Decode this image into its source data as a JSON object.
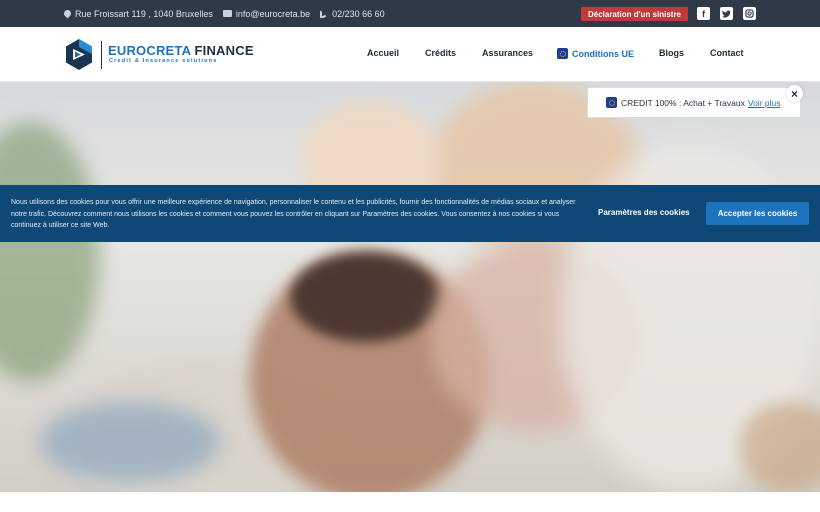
{
  "topbar": {
    "address": "Rue Froissart 119 , 1040 Bruxelles",
    "email": "info@eurocreta.be",
    "phone": "02/230 66 60",
    "sinistre_label": "Déclaration d'un sinistre",
    "icons": [
      "map-pin-icon",
      "mail-icon",
      "phone-icon",
      "facebook-icon",
      "twitter-icon",
      "instagram-icon"
    ],
    "colors": {
      "bar": "#2f3a48",
      "sinistre": "#c0393b"
    }
  },
  "brand": {
    "name_part1": "EUROCRETA",
    "name_part2": " FINANCE",
    "tagline": "Credit & Insurance solutions",
    "colors": {
      "primary": "#1e73be",
      "dark": "#1b2f45"
    }
  },
  "nav": {
    "items": [
      {
        "label": "Accueil"
      },
      {
        "label": "Crédits"
      },
      {
        "label": "Assurances"
      },
      {
        "label": "Conditions UE"
      },
      {
        "label": "Blogs"
      },
      {
        "label": "Contact"
      }
    ]
  },
  "notice": {
    "text": "CREDIT 100% : Achat + Travaux",
    "link": "Voir plus",
    "close": "×"
  },
  "cookie": {
    "text": "Nous utilisons des cookies pour vous offrir une meilleure expérience de navigation, personnaliser le contenu et les publicités, fournir des fonctionnalités de médias sociaux et analyser notre trafic. Découvrez comment nous utilisons les cookies et comment vous pouvez les contrôler en cliquant sur Paramètres des cookies. Vous consentez à nos cookies si vous continuez à utiliser ce site Web.",
    "settings_label": "Paramètres des cookies",
    "accept_label": "Accepter les cookies",
    "colors": {
      "banner": "#0d4877",
      "accept": "#1e73be"
    }
  }
}
